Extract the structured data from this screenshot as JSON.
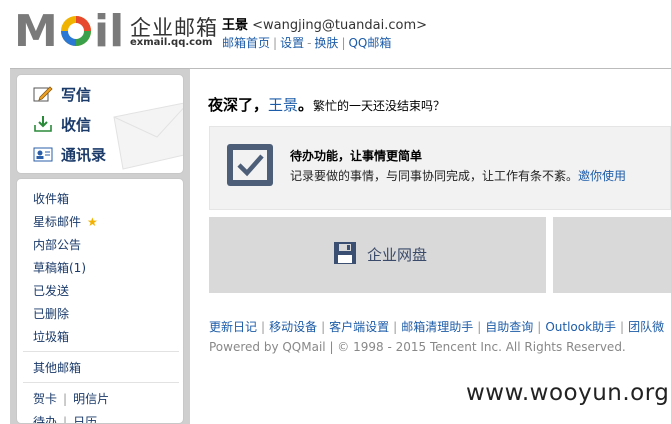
{
  "brand": {
    "logo_text": "MOil",
    "title": "企业邮箱",
    "subtitle": "exmail.qq.com"
  },
  "user": {
    "name": "王景",
    "email": "<wangjing@tuandai.com>"
  },
  "top_links": [
    "邮箱首页",
    "设置",
    "换肤",
    "QQ邮箱"
  ],
  "actions": [
    {
      "label": "写信",
      "icon": "pencil-icon"
    },
    {
      "label": "收信",
      "icon": "inbox-download-icon"
    },
    {
      "label": "通讯录",
      "icon": "contacts-card-icon"
    }
  ],
  "folders": {
    "inbox": "收件箱",
    "starred": "星标邮件",
    "announcements": "内部公告",
    "drafts": "草稿箱(1)",
    "sent": "已发送",
    "deleted": "已删除",
    "junk": "垃圾箱",
    "other": "其他邮箱",
    "cards": "贺卡",
    "postcards": "明信片",
    "todo": "待办",
    "calendar": "日历"
  },
  "greeting": {
    "prefix": "夜深了，",
    "name": "王景",
    "suffix": "。",
    "sub": "繁忙的一天还没结束吗？"
  },
  "todo": {
    "title": "待办功能，让事情更简单",
    "desc": "记录要做的事情，与同事协同完成，让工作有条不紊。",
    "link": "邀你使用"
  },
  "disk": {
    "label": "企业网盘"
  },
  "footer_links": [
    "更新日记",
    "移动设备",
    "客户端设置",
    "邮箱清理助手",
    "自助查询",
    "Outlook助手",
    "团队微"
  ],
  "copyright": "Powered by QQMail  | © 1998 - 2015 Tencent Inc. All Rights Reserved.",
  "watermark": "www.wooyun.org",
  "colors": {
    "link": "#1d5ca8",
    "star": "#f2b100",
    "panel_bg": "#cfcfcf"
  }
}
